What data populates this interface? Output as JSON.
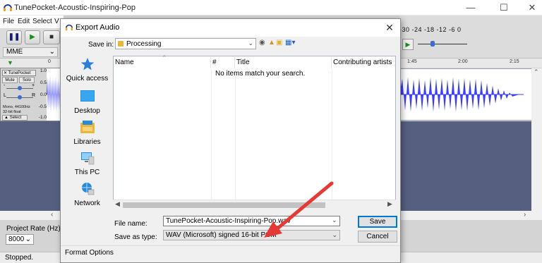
{
  "main_window": {
    "title": "TunePocket-Acoustic-Inspiring-Pop",
    "menu": {
      "file": "File",
      "edit": "Edit",
      "select": "Select",
      "view_partial": "V"
    },
    "device": "MME",
    "ruler": {
      "left_tick": "0",
      "right_ticks": [
        "1:45",
        "2:00",
        "2:15"
      ]
    },
    "meter_ticks": "-30  -24  -18  -12  -6  0",
    "track": {
      "name": "TunePocket",
      "mute": "Mute",
      "solo": "Solo",
      "gain_minus": "-",
      "gain_plus": "+",
      "pan_left": "L",
      "pan_right": "R",
      "info_rate": "Mono, 44100Hz",
      "info_format": "32-bit float",
      "select_button": "Select",
      "amplitude": [
        "1.0",
        "0.5",
        "0.0",
        "-0.5",
        "-1.0"
      ]
    },
    "project_rate_label": "Project Rate (Hz)",
    "project_rate_value": "8000",
    "status": "Stopped."
  },
  "dialog": {
    "title": "Export Audio",
    "save_in_label": "Save in:",
    "save_in_value": "Processing",
    "places": [
      "Quick access",
      "Desktop",
      "Libraries",
      "This PC",
      "Network"
    ],
    "columns": [
      "Name",
      "#",
      "Title",
      "Contributing artists"
    ],
    "empty_message": "No items match your search.",
    "file_name_label": "File name:",
    "file_name_value": "TunePocket-Acoustic-Inspiring-Pop.wav",
    "save_as_type_label": "Save as type:",
    "save_as_type_value": "WAV (Microsoft) signed 16-bit PCM",
    "save_button": "Save",
    "cancel_button": "Cancel",
    "format_options_label": "Format Options"
  },
  "colors": {
    "annotation_arrow": "#e53935",
    "waveform": "#3d3ff0",
    "track_background": "#565f80"
  },
  "icons": [
    "audacity-icon",
    "minimize-icon",
    "maximize-icon",
    "close-icon",
    "pause-icon",
    "play-icon",
    "stop-icon",
    "folder-icon",
    "back-icon",
    "up-folder-icon",
    "new-folder-icon",
    "view-menu-icon",
    "star-icon",
    "desktop-icon",
    "libraries-icon",
    "this-pc-icon",
    "network-icon"
  ]
}
